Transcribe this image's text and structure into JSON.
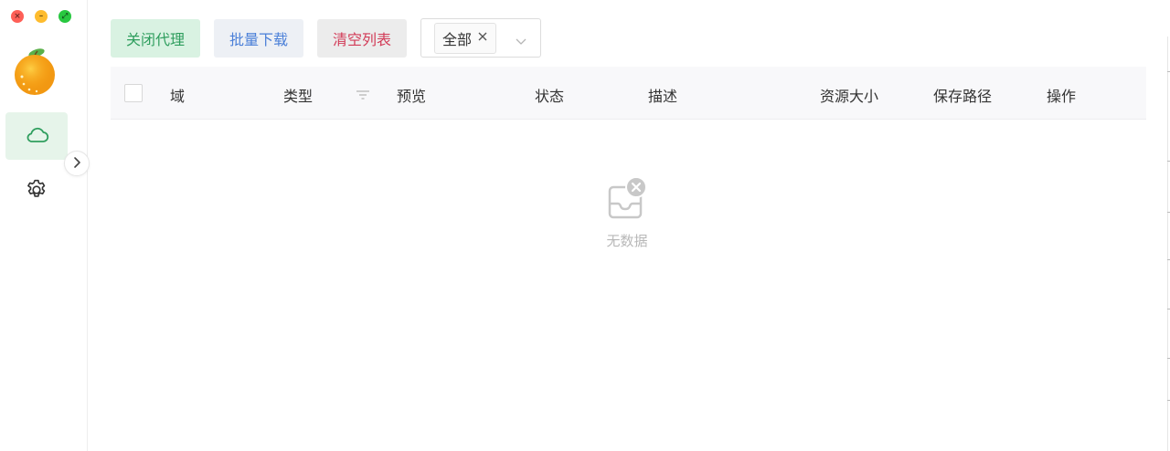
{
  "window": {
    "controls": {
      "close_glyph": "×",
      "minimize_glyph": "–",
      "maximize_glyph": "⤢"
    }
  },
  "sidebar": {
    "logo_icon": "orange-icon",
    "items": [
      {
        "id": "proxy",
        "icon": "cloud-icon",
        "active": true
      },
      {
        "id": "settings",
        "icon": "gear-icon",
        "active": false
      }
    ],
    "collapse_icon": "chevron-right-icon"
  },
  "toolbar": {
    "close_proxy_label": "关闭代理",
    "batch_download_label": "批量下载",
    "clear_list_label": "清空列表",
    "filter_select": {
      "selected_tag": "全部"
    }
  },
  "table": {
    "columns": {
      "domain": "域",
      "type": "类型",
      "preview": "预览",
      "status": "状态",
      "description": "描述",
      "size": "资源大小",
      "save_path": "保存路径",
      "actions": "操作"
    },
    "empty_text": "无数据"
  },
  "colors": {
    "accent_green": "#2f9e5e",
    "accent_blue": "#4a7fd8",
    "danger_red": "#d23b57",
    "active_nav_bg": "#e6f4ea"
  }
}
